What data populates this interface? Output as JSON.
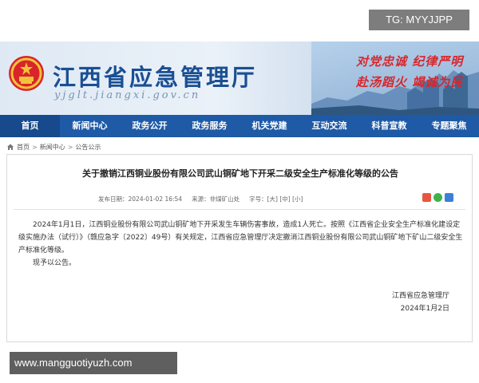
{
  "watermark": {
    "top": "TG: MYYJJPP",
    "bottom": "www.mangguotiyuzh.com"
  },
  "header": {
    "title": "江西省应急管理厅",
    "url": "yjglt.jiangxi.gov.cn",
    "slogan_line1": "对党忠诚 纪律严明",
    "slogan_line2": "赴汤蹈火 竭诚为民"
  },
  "nav": {
    "items": [
      {
        "label": "首页"
      },
      {
        "label": "新闻中心"
      },
      {
        "label": "政务公开"
      },
      {
        "label": "政务服务"
      },
      {
        "label": "机关党建"
      },
      {
        "label": "互动交流"
      },
      {
        "label": "科普宣教"
      },
      {
        "label": "专题聚焦"
      }
    ]
  },
  "breadcrumb": {
    "items": [
      "首页",
      "新闻中心",
      "公告公示"
    ],
    "separator": ">"
  },
  "article": {
    "title": "关于撤销江西铜业股份有限公司武山铜矿地下开采二级安全生产标准化等级的公告",
    "meta": {
      "published_label": "发布日期：2024-01-02 16:54",
      "source_label": "来源：非煤矿山处",
      "font_label": "字号：[大] [中] [小]"
    },
    "paragraphs": [
      "2024年1月1日，江西铜业股份有限公司武山铜矿地下开采发生车辆伤害事故，造成1人死亡。按照《江西省企业安全生产标准化建设定级实施办法（试行）》（赣应急字〔2022〕49号）有关规定，江西省应急管理厅决定撤消江西铜业股份有限公司武山铜矿地下矿山二级安全生产标准化等级。",
      "现予以公告。"
    ],
    "signature": "江西省应急管理厅",
    "date": "2024年1月2日"
  },
  "colors": {
    "nav_bg": "#1e5aa6",
    "title_blue": "#1a4f93",
    "slogan_red": "#d8262b"
  }
}
